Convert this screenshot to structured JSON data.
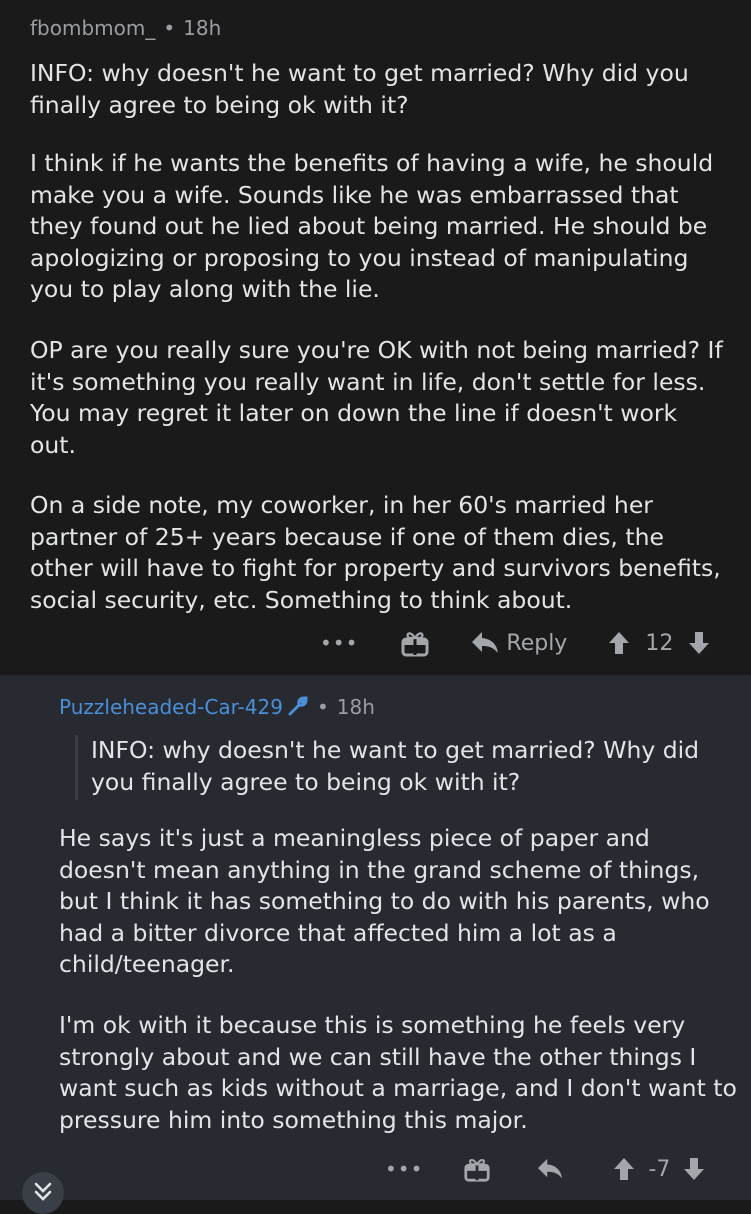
{
  "top_comment": {
    "username": "fbombmom_",
    "separator": "•",
    "time": "18h",
    "paragraphs": [
      "INFO: why doesn't he want to get married? Why did you finally agree to being ok with it?",
      "I think if he wants the benefits of having a wife, he should make you a wife.  Sounds like he was embarrassed that they found out he lied about being married.  He should be apologizing or proposing to you instead of manipulating you to play along with the lie.",
      "OP are you really sure you're OK with not being married? If it's something you really want in life,  don't settle for less.  You may regret it later on down the line if doesn't work out.",
      "On a side note, my coworker, in her 60's married her partner of 25+ years because if one of them dies, the other will have to fight for property and survivors benefits, social security, etc. Something to think about."
    ],
    "more": "•••",
    "reply_label": "Reply",
    "score": "12"
  },
  "reply_comment": {
    "username": "Puzzleheaded-Car-429",
    "separator": "•",
    "time": "18h",
    "quote": "INFO: why doesn't he want to get married? Why did you finally agree to being ok with it?",
    "paragraphs": [
      "He says it's just a meaningless piece of paper and doesn't mean anything in the grand scheme of things, but I think it has something to do with his parents, who had a bitter divorce that affected him a lot as a child/teenager.",
      "I'm ok with it because this is something he feels very strongly about and we can still have the other things I want such as kids without a marriage, and I don't want to pressure him into something this major."
    ],
    "more": "•••",
    "score": "-7"
  },
  "icons": [
    "wrench-icon",
    "award-gift-icon",
    "reply-arrow-icon",
    "upvote-arrow-icon",
    "downvote-arrow-icon",
    "chevron-double-down-icon"
  ],
  "colors": {
    "background_top": "#1a1a1b",
    "background_reply": "#272a31",
    "username_accent": "#4a8fd8",
    "text": "#e2e4e6",
    "muted": "#9a9ea3"
  }
}
